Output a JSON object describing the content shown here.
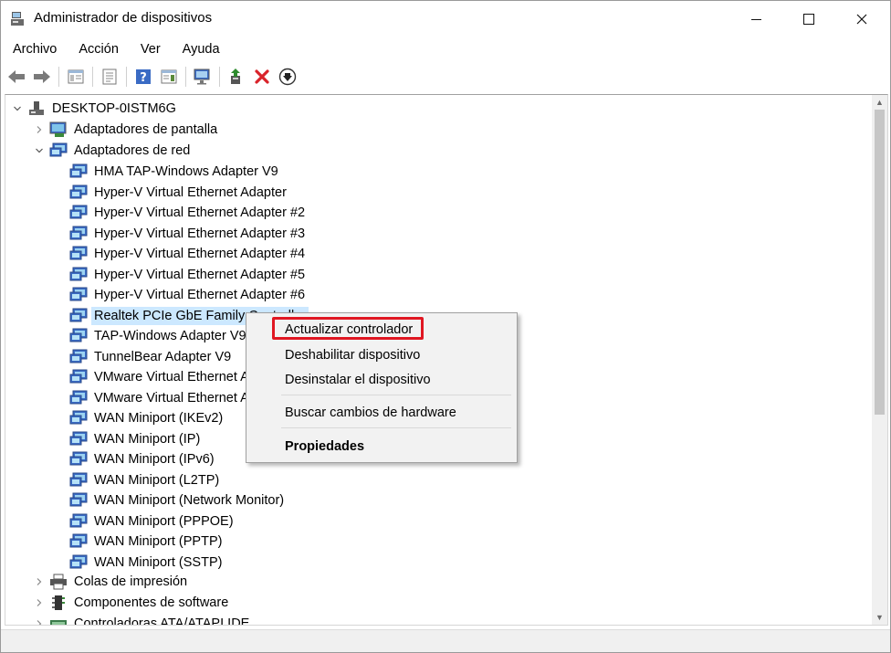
{
  "window": {
    "title": "Administrador de dispositivos"
  },
  "menu": [
    "Archivo",
    "Acción",
    "Ver",
    "Ayuda"
  ],
  "toolbar": {
    "buttons": [
      "back-icon",
      "forward-icon",
      "properties-icon",
      "show-hide-icon",
      "help-icon",
      "action-icon",
      "scan-monitor-icon",
      "update-driver-icon",
      "uninstall-icon",
      "download-icon"
    ]
  },
  "tree": {
    "root": "DESKTOP-0ISTM6G",
    "categories": {
      "display": "Adaptadores de pantalla",
      "network": "Adaptadores de red",
      "print": "Colas de impresión",
      "software": "Componentes de software",
      "ata": "Controladoras ATA/ATAPI IDE"
    },
    "network_adapters": [
      "HMA TAP-Windows Adapter V9",
      "Hyper-V Virtual Ethernet Adapter",
      "Hyper-V Virtual Ethernet Adapter #2",
      "Hyper-V Virtual Ethernet Adapter #3",
      "Hyper-V Virtual Ethernet Adapter #4",
      "Hyper-V Virtual Ethernet Adapter #5",
      "Hyper-V Virtual Ethernet Adapter #6",
      "Realtek PCIe GbE Family Controller",
      "TAP-Windows Adapter V9",
      "TunnelBear Adapter V9",
      "VMware Virtual Ethernet Adapter for VMnet1",
      "VMware Virtual Ethernet Adapter for VMnet8",
      "WAN Miniport (IKEv2)",
      "WAN Miniport (IP)",
      "WAN Miniport (IPv6)",
      "WAN Miniport (L2TP)",
      "WAN Miniport (Network Monitor)",
      "WAN Miniport (PPPOE)",
      "WAN Miniport (PPTP)",
      "WAN Miniport (SSTP)"
    ],
    "selected_item": "Realtek PCIe GbE Family Controller"
  },
  "context_menu": {
    "update": "Actualizar controlador",
    "disable": "Deshabilitar dispositivo",
    "uninstall": "Desinstalar el dispositivo",
    "scan": "Buscar cambios de hardware",
    "properties": "Propiedades"
  },
  "colors": {
    "selection": "#cce8ff",
    "highlight_box": "#e01722",
    "uninstall_red": "#d9232a",
    "update_green": "#2e8b2e"
  }
}
